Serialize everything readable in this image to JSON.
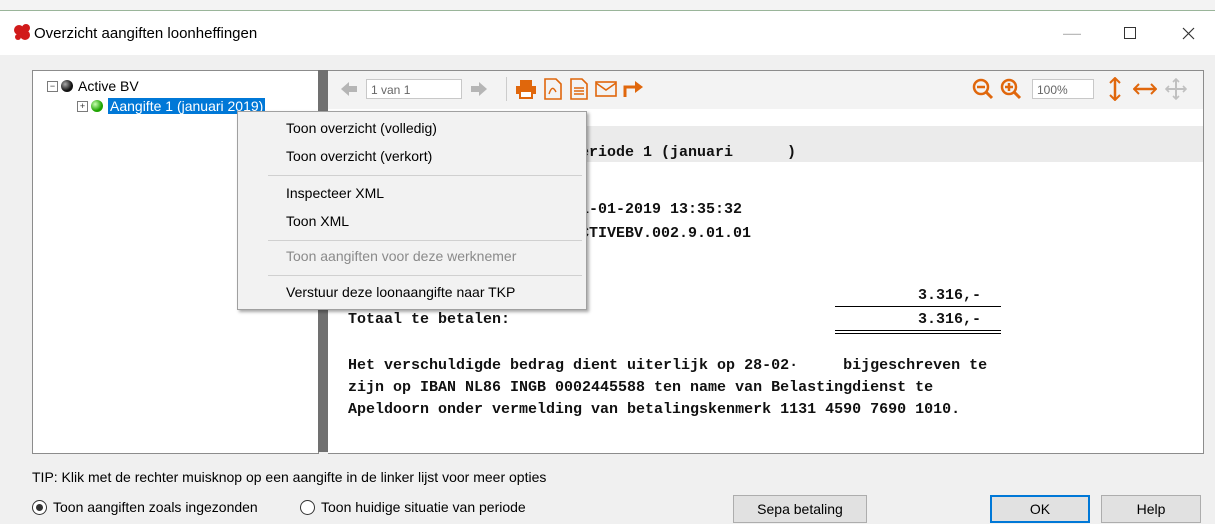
{
  "window": {
    "title": "Overzicht aangiften loonheffingen"
  },
  "tree": {
    "root": "Active BV",
    "child": "Aangifte 1 (januari 2019)"
  },
  "toolbar": {
    "page_value": "1 van 1",
    "zoom_value": "100%"
  },
  "report": {
    "line_periode": "eriode 1 (januari      )",
    "line_datum": "1-01-2019 13:35:32",
    "line_kenmerk": "CTIVEBV.002.9.01.01",
    "line_colon": ":",
    "amount_1": "3.316,-",
    "totaal_label": "Totaal te betalen:",
    "amount_2": "3.316,-",
    "para_1": "Het verschuldigde bedrag dient uiterlijk op 28-02·     bijgeschreven te",
    "para_2": "zijn op IBAN NL86 INGB 0002445588 ten name van Belastingdienst te",
    "para_3": "Apeldoorn onder vermelding van betalingskenmerk 1131 4590 7690 1010."
  },
  "context_menu": {
    "items": [
      {
        "label": "Toon overzicht (volledig)",
        "enabled": true
      },
      {
        "label": "Toon overzicht (verkort)",
        "enabled": true
      },
      {
        "label": "Inspecteer XML",
        "enabled": true
      },
      {
        "label": "Toon XML",
        "enabled": true
      },
      {
        "label": "Toon aangiften voor deze werknemer",
        "enabled": false
      },
      {
        "label": "Verstuur deze loonaangifte naar TKP",
        "enabled": true
      }
    ]
  },
  "footer": {
    "tip": "TIP: Klik met de rechter muisknop op een aangifte in de linker lijst voor meer opties",
    "radio_1": "Toon aangiften zoals ingezonden",
    "radio_2": "Toon huidige situatie van periode",
    "sepa_button": "Sepa betaling",
    "ok_button": "OK",
    "help_button": "Help"
  },
  "colors": {
    "accent": "#0078d7",
    "toolbar_orange": "#e0670c",
    "status_green": "#1ea300"
  }
}
